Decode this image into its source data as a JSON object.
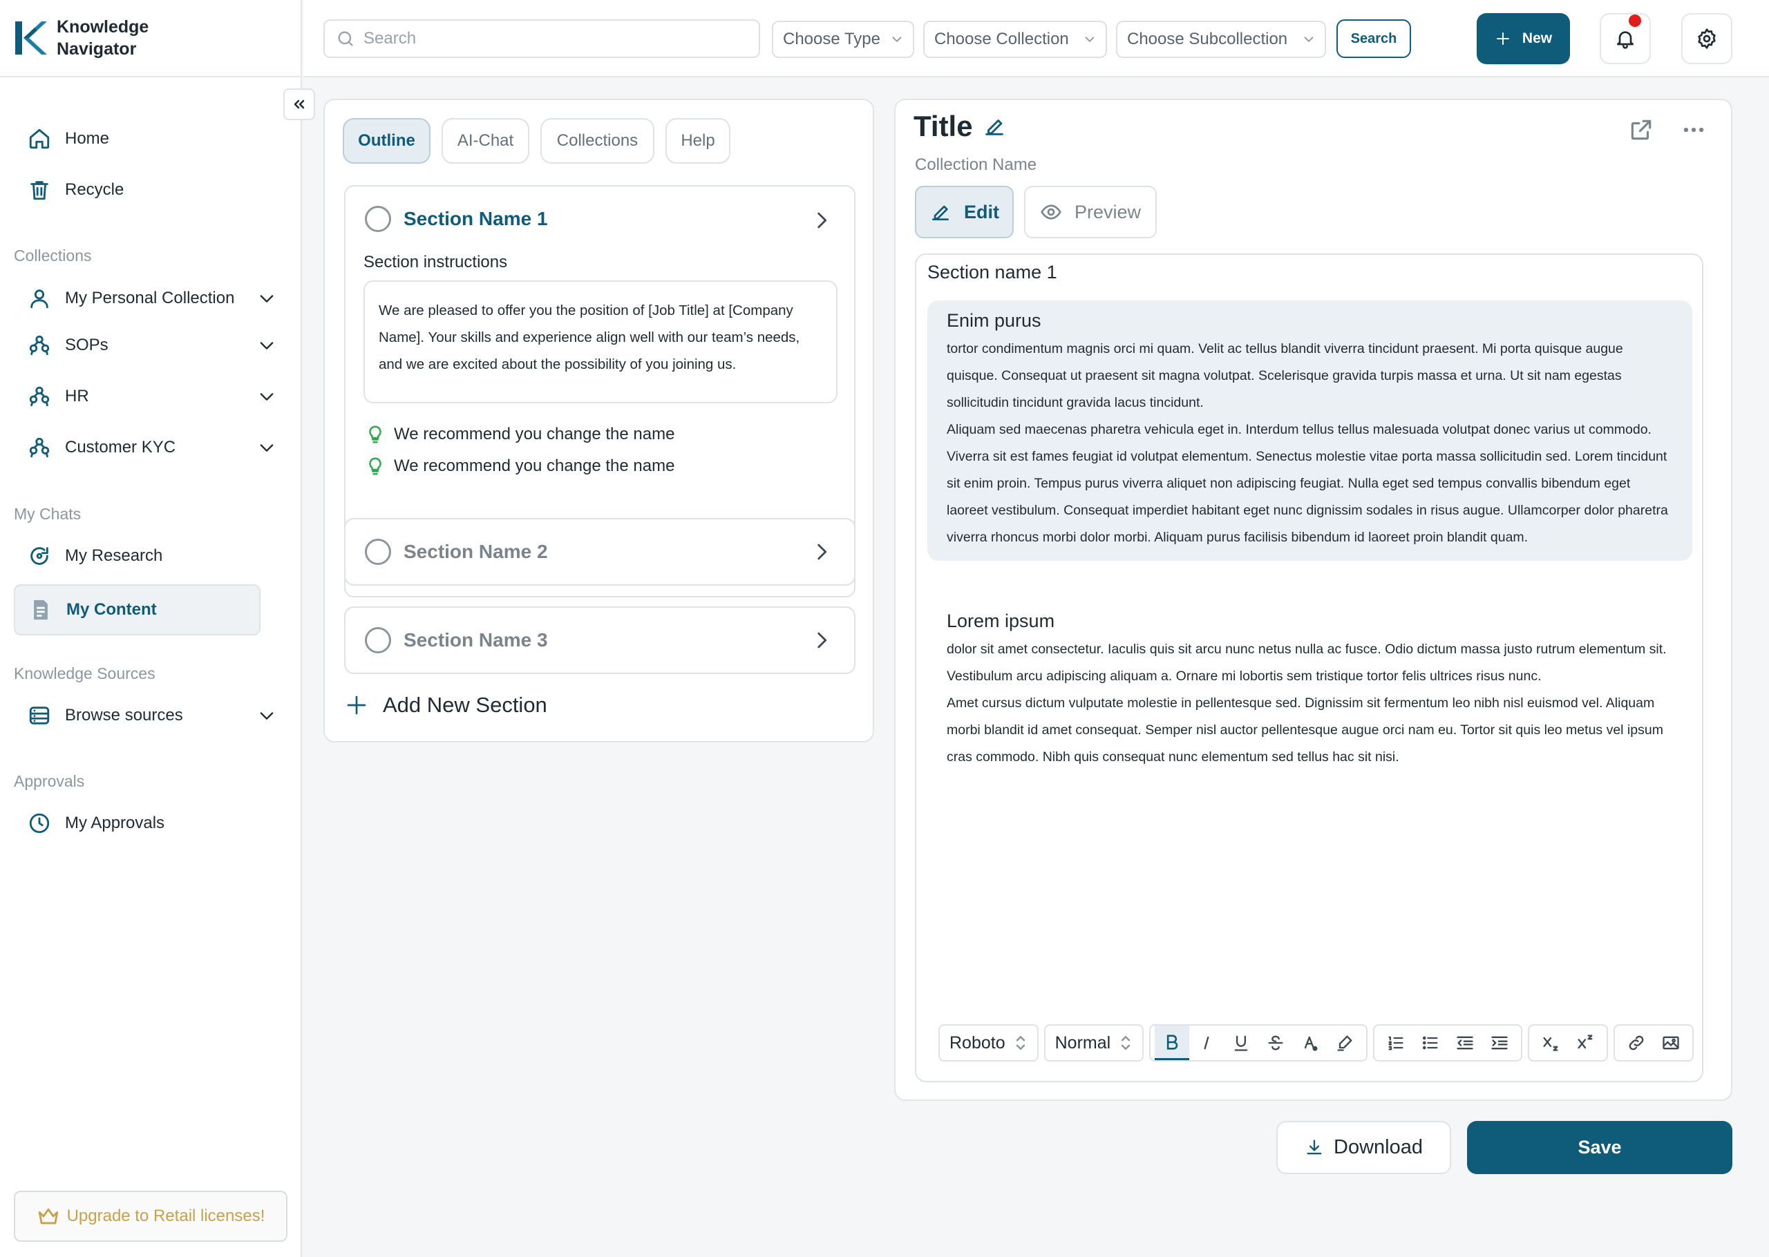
{
  "app": {
    "name_line1": "Knowledge",
    "name_line2": "Navigator"
  },
  "header": {
    "search_placeholder": "Search",
    "type_select": "Choose Type",
    "collection_select": "Choose Collection",
    "subcollection_select": "Choose Subcollection",
    "search_button": "Search",
    "new_button": "New"
  },
  "sidebar": {
    "home": "Home",
    "recycle": "Recycle",
    "collections_heading": "Collections",
    "collections": [
      {
        "label": "My Personal Collection",
        "icon": "user-icon"
      },
      {
        "label": "SOPs",
        "icon": "group-icon"
      },
      {
        "label": "HR",
        "icon": "group-icon"
      },
      {
        "label": "Customer KYC",
        "icon": "group-icon"
      }
    ],
    "chats_heading": "My Chats",
    "my_research": "My Research",
    "my_content": "My Content",
    "sources_heading": "Knowledge Sources",
    "browse_sources": "Browse sources",
    "approvals_heading": "Approvals",
    "my_approvals": "My Approvals",
    "upgrade": "Upgrade to Retail licenses!"
  },
  "outline": {
    "tabs": [
      "Outline",
      "AI-Chat",
      "Collections",
      "Help"
    ],
    "sections": [
      {
        "name": "Section Name 1"
      },
      {
        "name": "Section Name 2"
      },
      {
        "name": "Section Name 3"
      }
    ],
    "instructions_label": "Section instructions",
    "instructions_text": "We are pleased to offer you the position of [Job Title] at [Company Name]. Your skills and experience align well with our team’s needs, and we are excited about the possibility of you joining us.",
    "recommendations": [
      "We recommend you change the name",
      "We recommend you change the name"
    ],
    "add_section": "Add New Section"
  },
  "editor": {
    "title": "Title",
    "collection_name": "Collection Name",
    "edit_button": "Edit",
    "preview_button": "Preview",
    "section_heading": "Section name 1",
    "blocks": [
      {
        "title": "Enim purus",
        "text": "tortor condimentum magnis orci mi quam. Velit ac tellus blandit viverra tincidunt praesent. Mi porta quisque augue quisque. Consequat ut praesent sit magna volutpat. Scelerisque gravida turpis massa et urna. Ut sit nam egestas sollicitudin tincidunt gravida lacus tincidunt.",
        "text2": "Aliquam sed maecenas pharetra vehicula eget in. Interdum tellus tellus malesuada volutpat donec varius ut commodo. Viverra sit est fames feugiat id volutpat elementum. Senectus molestie vitae porta massa sollicitudin sed. Lorem tincidunt sit enim proin. Tempus purus viverra aliquet non adipiscing feugiat. Nulla eget sed tempus convallis bibendum eget laoreet vestibulum. Consequat imperdiet habitant eget nunc dignissim sodales in risus augue. Ullamcorper dolor pharetra viverra rhoncus morbi dolor morbi. Aliquam purus facilisis bibendum id laoreet proin blandit quam."
      },
      {
        "title": "Lorem ipsum",
        "text": "dolor sit amet consectetur. Iaculis quis sit arcu nunc netus nulla ac fusce. Odio dictum massa justo rutrum elementum sit. Vestibulum arcu adipiscing aliquam a. Ornare mi lobortis sem tristique tortor felis ultrices risus nunc.",
        "text2": "Amet cursus dictum vulputate molestie in pellentesque sed. Dignissim sit fermentum leo nibh nisl euismod vel. Aliquam morbi blandit id amet consequat. Semper nisl auctor pellentesque augue orci nam eu. Tortor sit quis leo metus vel ipsum cras commodo. Nibh quis consequat nunc elementum sed tellus hac sit nisi."
      }
    ],
    "toolbar": {
      "font": "Roboto",
      "style": "Normal"
    }
  },
  "actions": {
    "download": "Download",
    "save": "Save"
  },
  "colors": {
    "accent": "#0f5b7a",
    "highlight_bg": "#ebf0f5",
    "success": "#2fa84f",
    "notification": "#e01e1e",
    "upgrade": "#c7a24a"
  }
}
